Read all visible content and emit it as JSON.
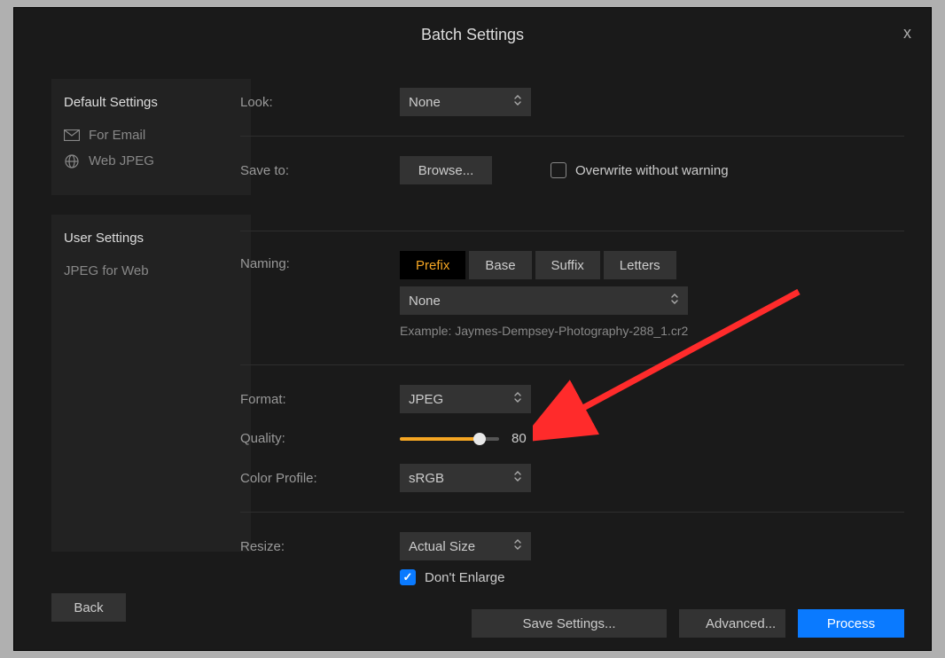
{
  "title": "Batch Settings",
  "sidebar": {
    "default_title": "Default Settings",
    "default_items": [
      {
        "label": "For Email"
      },
      {
        "label": "Web JPEG"
      }
    ],
    "user_title": "User Settings",
    "user_items": [
      {
        "label": "JPEG for Web"
      }
    ]
  },
  "look": {
    "label": "Look:",
    "value": "None"
  },
  "save": {
    "label": "Save to:",
    "browse": "Browse...",
    "overwrite": "Overwrite without warning",
    "overwrite_checked": false
  },
  "naming": {
    "label": "Naming:",
    "tabs": [
      "Prefix",
      "Base",
      "Suffix",
      "Letters"
    ],
    "active": "Prefix",
    "value": "None",
    "example": "Example: Jaymes-Dempsey-Photography-288_1.cr2"
  },
  "format": {
    "label": "Format:",
    "value": "JPEG"
  },
  "quality": {
    "label": "Quality:",
    "value": 80,
    "percent": 80
  },
  "profile": {
    "label": "Color Profile:",
    "value": "sRGB"
  },
  "resize": {
    "label": "Resize:",
    "value": "Actual Size",
    "dont_enlarge": "Don't Enlarge",
    "dont_enlarge_checked": true
  },
  "buttons": {
    "back": "Back",
    "save": "Save Settings...",
    "advanced": "Advanced...",
    "process": "Process"
  }
}
